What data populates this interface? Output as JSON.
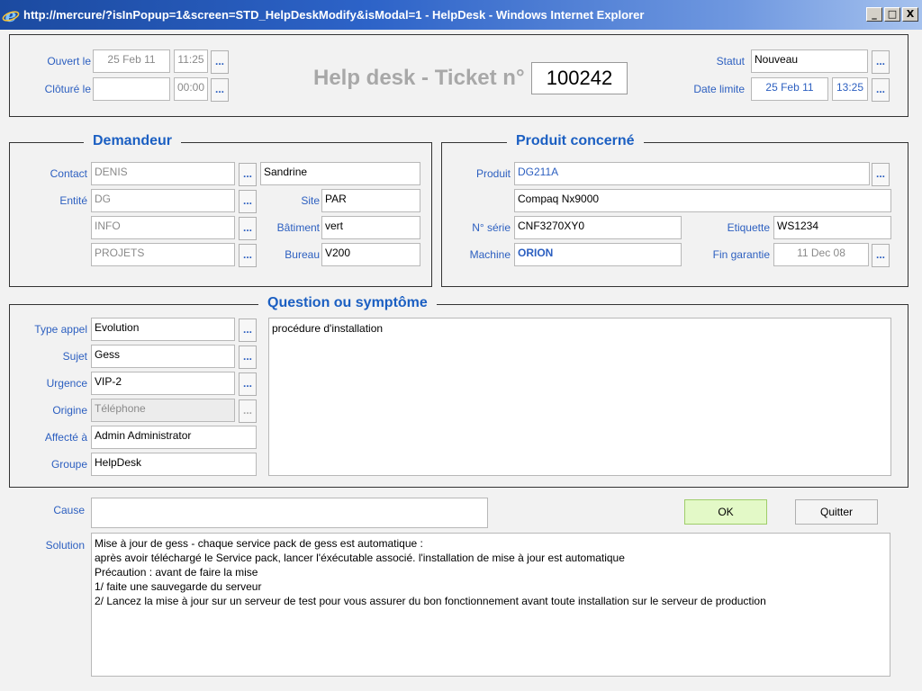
{
  "window": {
    "title": "http://mercure/?isInPopup=1&screen=STD_HelpDeskModify&isModal=1 - HelpDesk - Windows Internet Explorer",
    "minimize": "_",
    "maximize": "□",
    "close": "X"
  },
  "header": {
    "opened_label": "Ouvert le",
    "opened_date": "25 Feb 11",
    "opened_time": "11:25",
    "closed_label": "Clôturé le",
    "closed_date": "",
    "closed_time": "00:00",
    "ticket_title": "Help desk - Ticket n°",
    "ticket_number": "100242",
    "status_label": "Statut",
    "status_value": "Nouveau",
    "deadline_label": "Date limite",
    "deadline_date": "25 Feb 11",
    "deadline_time": "13:25",
    "ellipsis": "..."
  },
  "requester": {
    "legend": "Demandeur",
    "contact_label": "Contact",
    "contact_value": "DENIS",
    "first_name": "Sandrine",
    "entity_label": "Entité",
    "entity_value": "DG",
    "entity_2": "INFO",
    "entity_3": "PROJETS",
    "site_label": "Site",
    "site_value": "PAR",
    "building_label": "Bâtiment",
    "building_value": "vert",
    "office_label": "Bureau",
    "office_value": "V200"
  },
  "product": {
    "legend": "Produit concerné",
    "product_label": "Produit",
    "product_code": "DG211A",
    "product_name": "Compaq Nx9000",
    "serial_label": "N° série",
    "serial_value": "CNF3270XY0",
    "tag_label": "Etiquette",
    "tag_value": "WS1234",
    "machine_label": "Machine",
    "machine_value": "ORION",
    "warranty_label": "Fin garantie",
    "warranty_value": "11 Dec 08"
  },
  "question": {
    "legend": "Question ou symptôme",
    "call_type_label": "Type appel",
    "call_type_value": "Evolution",
    "subject_label": "Sujet",
    "subject_value": "Gess",
    "urgency_label": "Urgence",
    "urgency_value": "VIP-2",
    "origin_label": "Origine",
    "origin_value": "Téléphone",
    "assigned_label": "Affecté à",
    "assigned_value": "Admin Administrator",
    "group_label": "Groupe",
    "group_value": "HelpDesk",
    "description": "procédure d'installation"
  },
  "footer": {
    "cause_label": "Cause",
    "cause_value": "",
    "ok_label": "OK",
    "quit_label": "Quitter",
    "solution_label": "Solution",
    "solution_value": "Mise à jour de gess - chaque service pack de gess est automatique :\naprès avoir téléchargé le Service pack, lancer l'éxécutable associé. l'installation de mise à jour est automatique\nPrécaution : avant de faire la mise\n1/ faite une sauvegarde du serveur\n2/ Lancez la mise à jour sur un serveur de test pour vous assurer du bon fonctionnement avant toute installation sur le serveur de production"
  }
}
